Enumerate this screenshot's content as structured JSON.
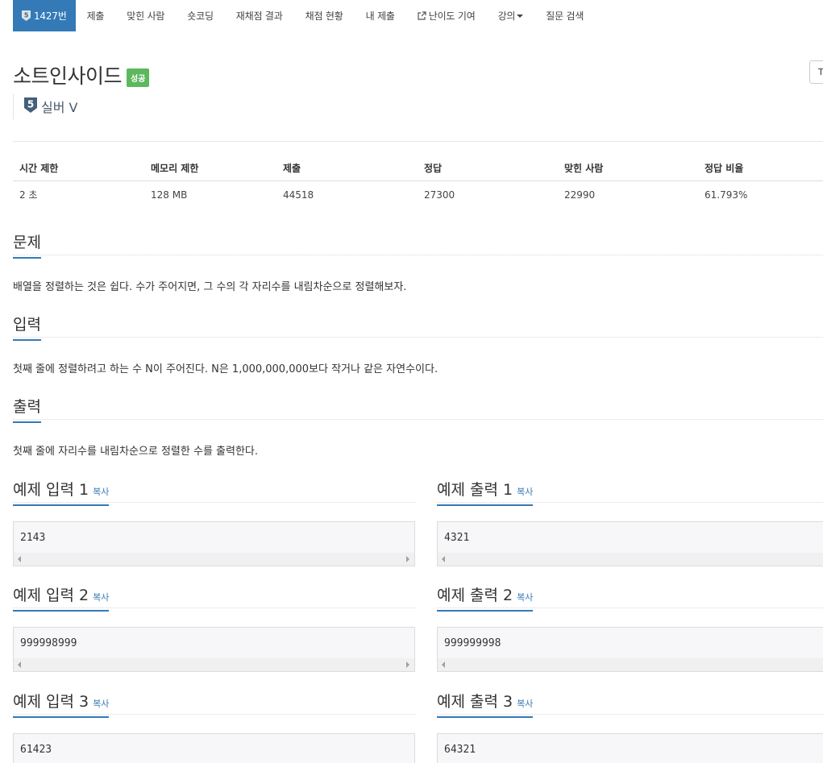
{
  "nav": {
    "tabs": [
      {
        "label": "1427번",
        "icon": "tier-silver-5-icon",
        "active": true
      },
      {
        "label": "제출"
      },
      {
        "label": "맞힌 사람"
      },
      {
        "label": "숏코딩"
      },
      {
        "label": "재채점 결과"
      },
      {
        "label": "채점 현황"
      },
      {
        "label": "내 제출"
      },
      {
        "label": "난이도 기여",
        "icon": "external-link-icon"
      },
      {
        "label": "강의",
        "icon": "caret-down-icon"
      },
      {
        "label": "질문 검색"
      }
    ]
  },
  "problem": {
    "title": "소트인사이드",
    "status_badge": "성공",
    "tier_label": "실버 V",
    "tier_icon": "tier-silver-5-icon",
    "tier_number": "5"
  },
  "info": {
    "headers": [
      "시간 제한",
      "메모리 제한",
      "제출",
      "정답",
      "맞힌 사람",
      "정답 비율"
    ],
    "values": [
      "2 초",
      "128 MB",
      "44518",
      "27300",
      "22990",
      "61.793%"
    ]
  },
  "sections": {
    "problem_heading": "문제",
    "problem_text": "배열을 정렬하는 것은 쉽다. 수가 주어지면, 그 수의 각 자리수를 내림차순으로 정렬해보자.",
    "input_heading": "입력",
    "input_text": "첫째 줄에 정렬하려고 하는 수 N이 주어진다. N은 1,000,000,000보다 작거나 같은 자연수이다.",
    "output_heading": "출력",
    "output_text": "첫째 줄에 자리수를 내림차순으로 정렬한 수를 출력한다."
  },
  "examples": {
    "copy_label": "복사",
    "input1_heading": "예제 입력 1",
    "output1_heading": "예제 출력 1",
    "input1": "2143",
    "output1": "4321",
    "input2_heading": "예제 입력 2",
    "output2_heading": "예제 출력 2",
    "input2": "999998999",
    "output2": "999999998",
    "input3_heading": "예제 입력 3",
    "output3_heading": "예제 출력 3",
    "input3": "61423",
    "output3": "64321"
  },
  "colors": {
    "accent": "#337ab7",
    "success": "#5cb85c",
    "tier_silver": "#435f7a"
  }
}
